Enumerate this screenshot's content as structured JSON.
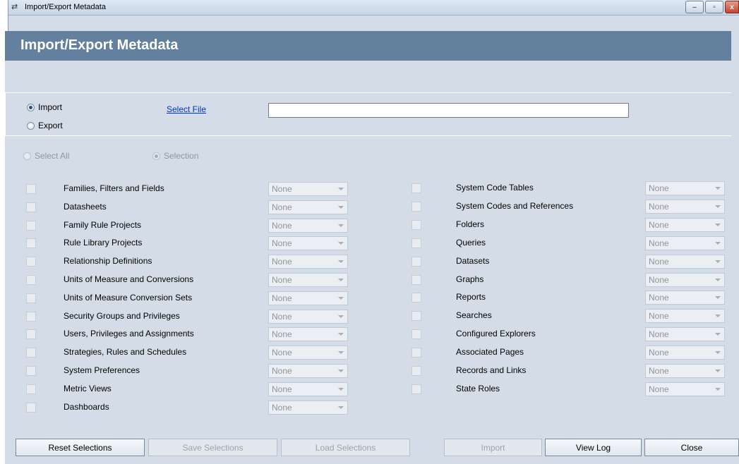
{
  "window": {
    "title": "Import/Export Metadata",
    "minimize_glyph": "‒",
    "maximize_glyph": "▫",
    "close_glyph": "x"
  },
  "header": {
    "title": "Import/Export Metadata"
  },
  "io": {
    "import_label": "Import",
    "export_label": "Export",
    "selected": "Import",
    "select_file_label": "Select File",
    "file_path_value": ""
  },
  "scope": {
    "select_all_label": "Select All",
    "selection_label": "Selection",
    "selected": "Selection"
  },
  "left_items": [
    {
      "label": "Families, Filters and Fields",
      "value": "None"
    },
    {
      "label": "Datasheets",
      "value": "None"
    },
    {
      "label": "Family Rule Projects",
      "value": "None"
    },
    {
      "label": "Rule Library Projects",
      "value": "None"
    },
    {
      "label": "Relationship Definitions",
      "value": "None"
    },
    {
      "label": "Units of Measure and Conversions",
      "value": "None"
    },
    {
      "label": "Units of Measure Conversion Sets",
      "value": "None"
    },
    {
      "label": "Security Groups and Privileges",
      "value": "None"
    },
    {
      "label": "Users, Privileges and Assignments",
      "value": "None"
    },
    {
      "label": "Strategies, Rules and Schedules",
      "value": "None"
    },
    {
      "label": "System Preferences",
      "value": "None"
    },
    {
      "label": "Metric Views",
      "value": "None"
    },
    {
      "label": "Dashboards",
      "value": "None"
    }
  ],
  "right_items": [
    {
      "label": "System Code Tables",
      "value": "None"
    },
    {
      "label": "System Codes and References",
      "value": "None"
    },
    {
      "label": "Folders",
      "value": "None"
    },
    {
      "label": "Queries",
      "value": "None"
    },
    {
      "label": "Datasets",
      "value": "None"
    },
    {
      "label": "Graphs",
      "value": "None"
    },
    {
      "label": "Reports",
      "value": "None"
    },
    {
      "label": "Searches",
      "value": "None"
    },
    {
      "label": "Configured Explorers",
      "value": "None"
    },
    {
      "label": "Associated Pages",
      "value": "None"
    },
    {
      "label": "Records and Links",
      "value": "None"
    },
    {
      "label": "State Roles",
      "value": "None"
    }
  ],
  "buttons": {
    "reset": "Reset Selections",
    "save": "Save Selections",
    "load": "Load Selections",
    "import": "Import",
    "view_log": "View Log",
    "close": "Close"
  }
}
